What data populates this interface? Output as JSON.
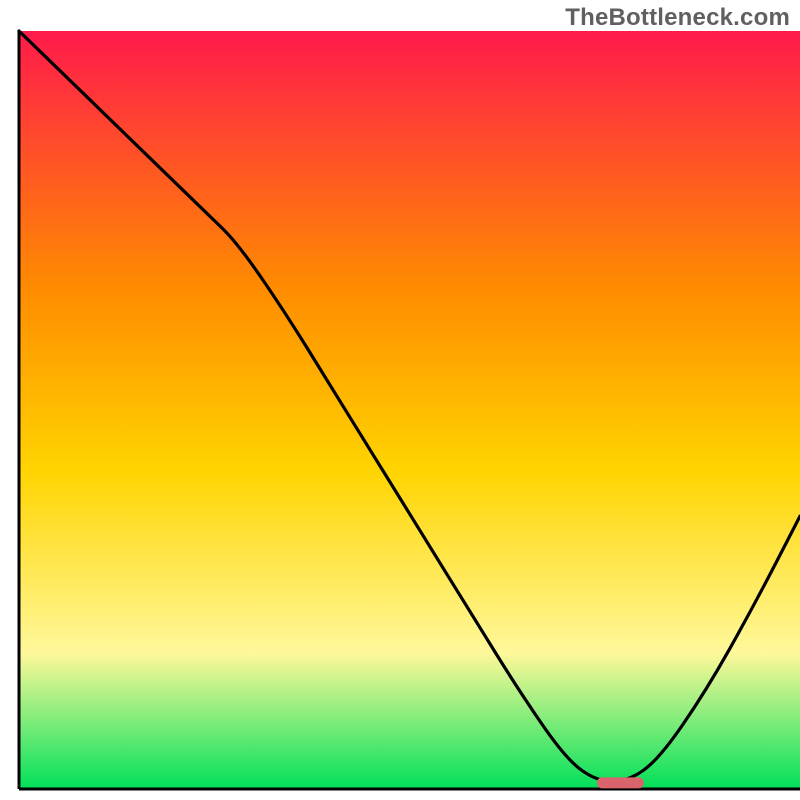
{
  "watermark": "TheBottleneck.com",
  "chart_data": {
    "type": "line",
    "title": "",
    "xlabel": "",
    "ylabel": "",
    "xlim": [
      0,
      100
    ],
    "ylim": [
      0,
      100
    ],
    "background_gradient": {
      "top": "#ff1a4b",
      "upper_mid": "#ff8c00",
      "mid": "#ffd400",
      "lower_mid": "#fff89a",
      "bottom": "#00e05a"
    },
    "curve": {
      "comment": "Approximate y-values (0 = bottom/green, 100 = top/red) read off the plot at sampled x positions 0–100.",
      "x": [
        0,
        6,
        12,
        18,
        24,
        28,
        34,
        40,
        46,
        52,
        58,
        64,
        70,
        74,
        78,
        82,
        88,
        94,
        100
      ],
      "y": [
        100,
        94,
        88,
        82,
        76,
        72,
        63,
        53,
        43,
        33,
        23,
        13,
        4,
        1,
        1,
        4,
        13,
        24,
        36
      ]
    },
    "marker": {
      "comment": "Short red rounded segment at the valley floor.",
      "x_start": 74,
      "x_end": 80,
      "y": 0.8,
      "color": "#d9646b"
    },
    "axes": {
      "color": "#000000",
      "left_x": 2.5,
      "bottom_y": 0,
      "top_y": 4,
      "right_x": 100
    }
  }
}
